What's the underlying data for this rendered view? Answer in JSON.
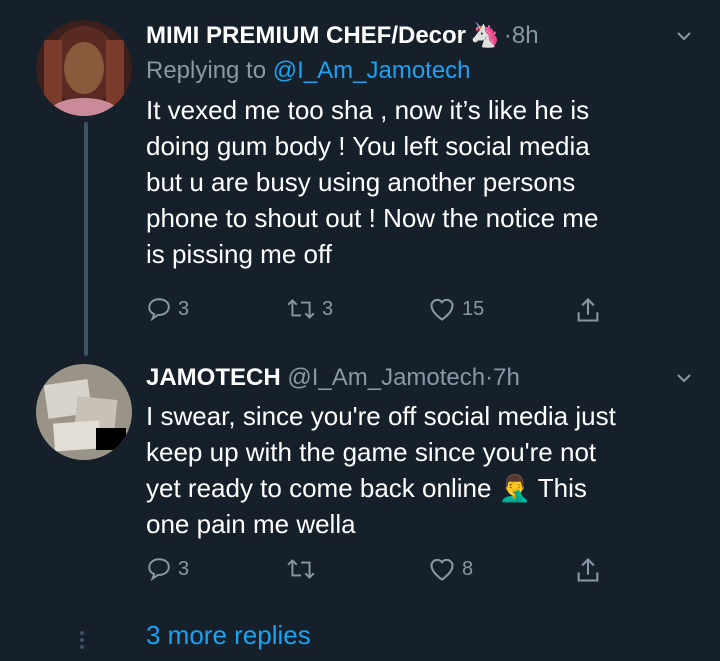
{
  "tweets": [
    {
      "name": "MIMI PREMIUM CHEF/Decor",
      "name_emoji": "🦄",
      "separator": "·",
      "time": "8h",
      "replying_prefix": "Replying to ",
      "replying_to": "@I_Am_Jamotech",
      "text": "It vexed me too sha , now it’s like he is\ndoing gum body ! You left social media\nbut u are busy using another persons\nphone to shout out ! Now the notice me\nis pissing  me off",
      "replies": "3",
      "retweets": "3",
      "likes": "15"
    },
    {
      "name": "JAMOTECH",
      "handle": "@I_Am_Jamotech",
      "separator": "·",
      "time": "7h",
      "text": "I swear, since you're off social media just\nkeep up with the game since you're not\nyet ready to come back online 🤦‍♂️  This\none pain me wella",
      "replies": "3",
      "retweets": "",
      "likes": "8"
    }
  ],
  "more_replies": "3 more replies",
  "colors": {
    "background": "#15202b",
    "accent": "#1da1f2",
    "muted": "#8899a6"
  }
}
